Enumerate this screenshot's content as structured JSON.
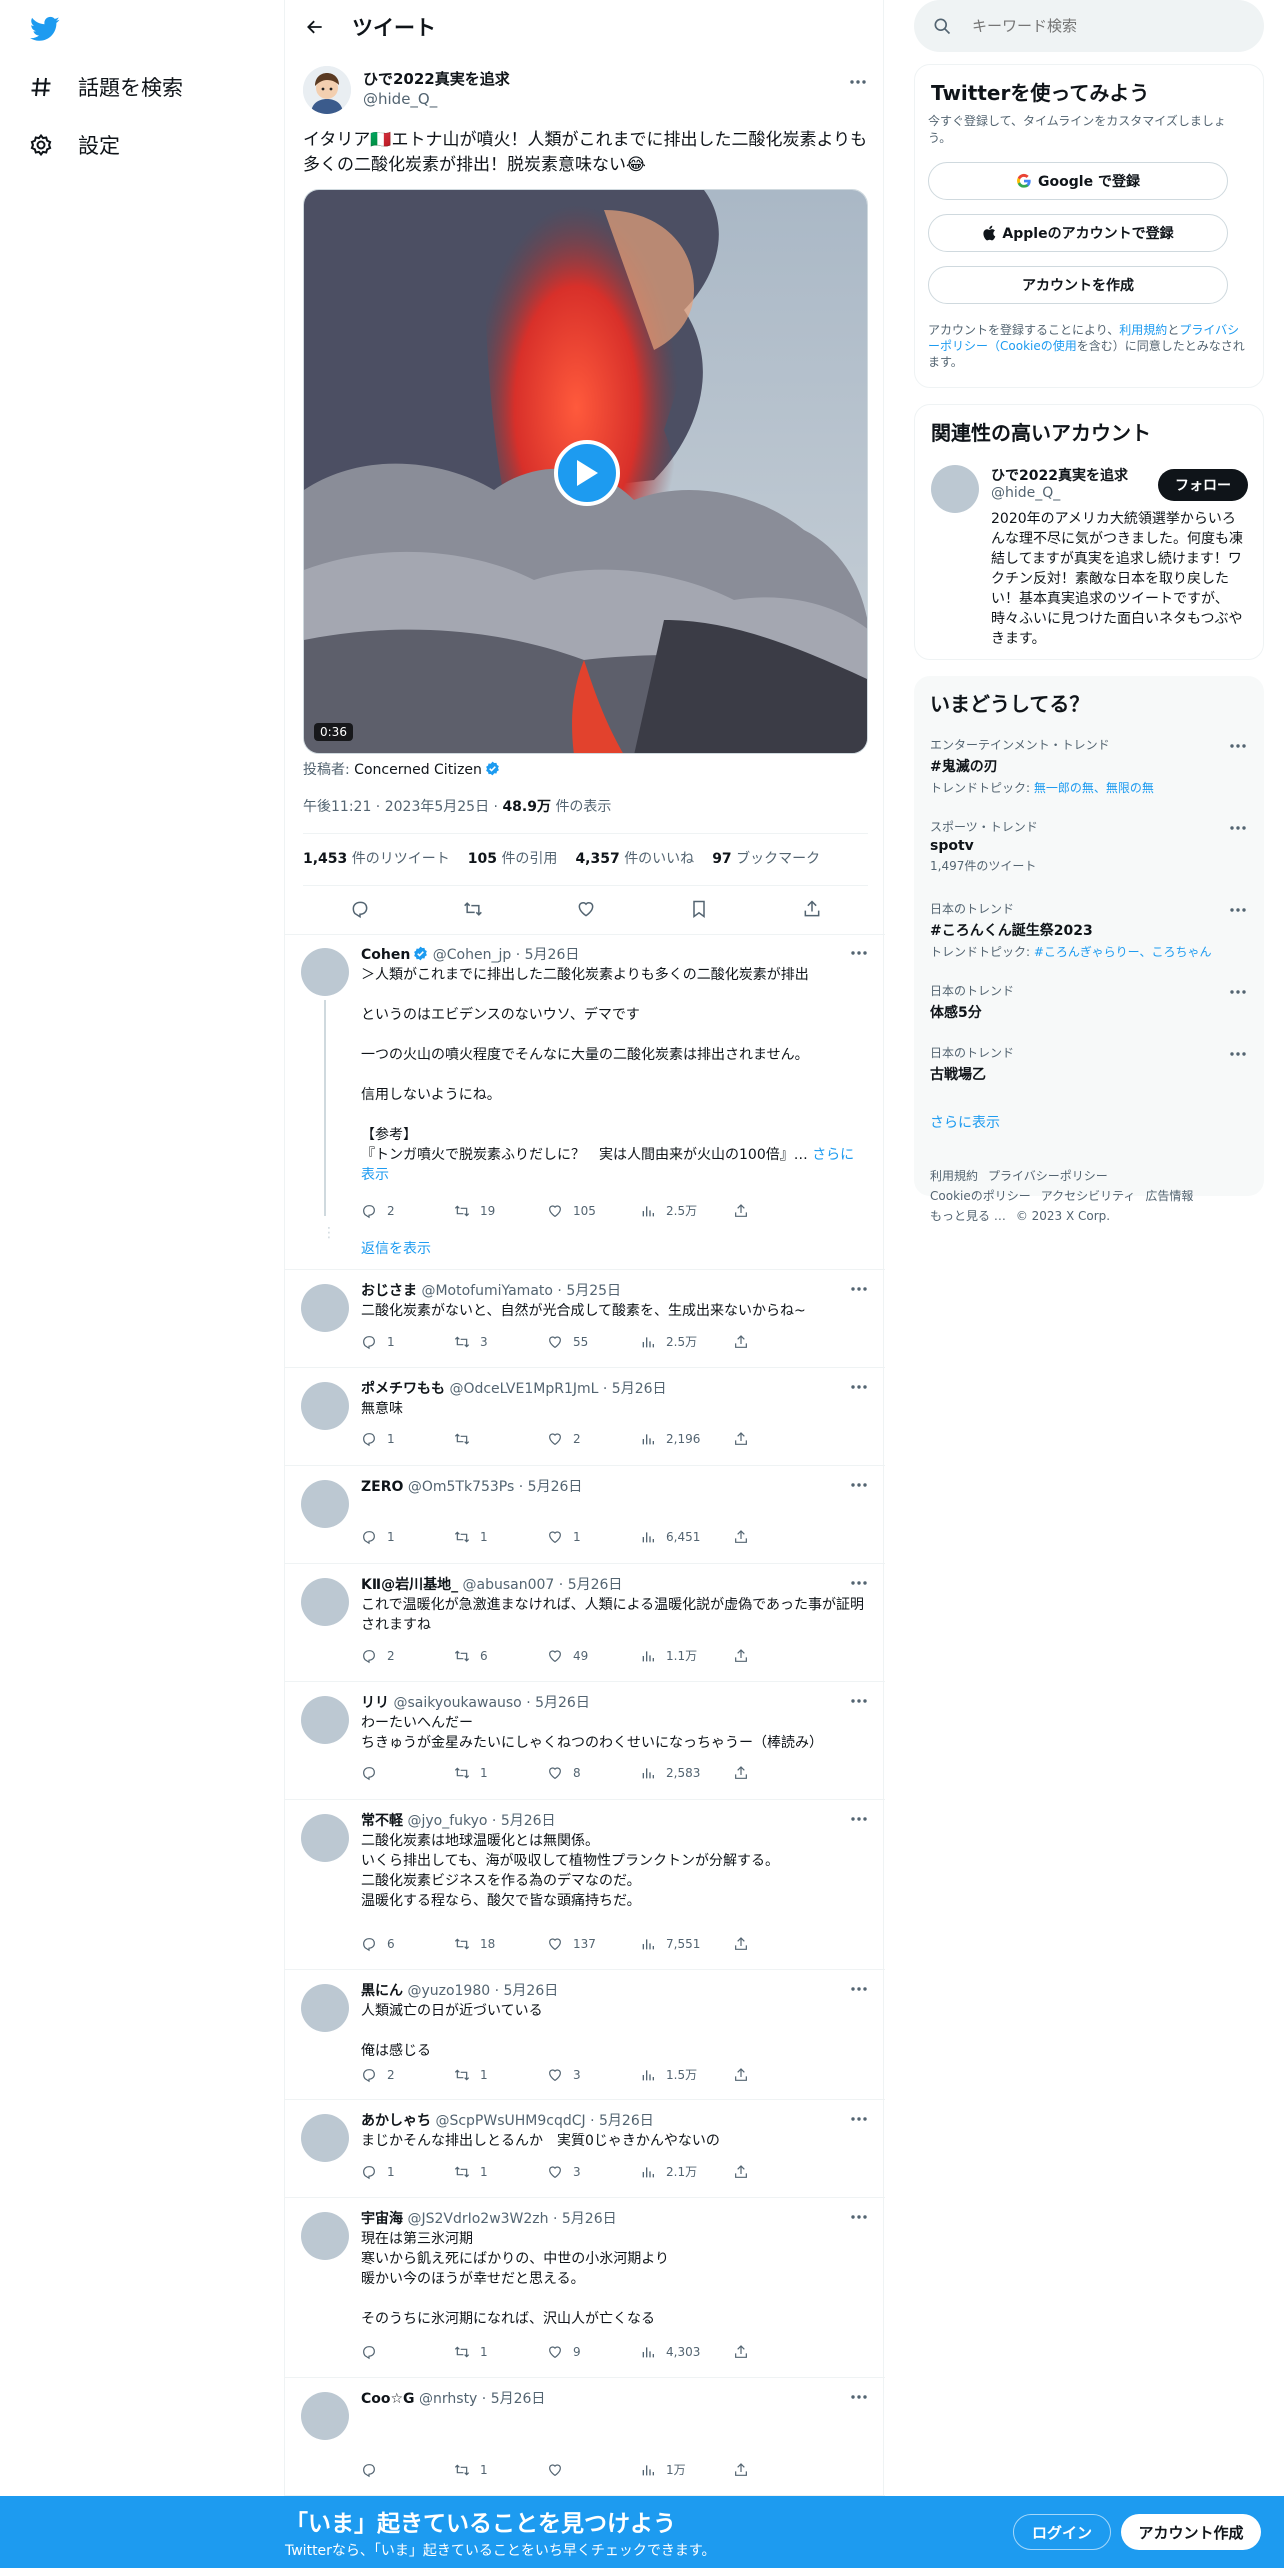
{
  "nav": {
    "explore_label": "話題を検索",
    "settings_label": "設定"
  },
  "header": {
    "title": "ツイート"
  },
  "tweet": {
    "author_name": "ひで2022真実を追求",
    "author_handle": "@hide_Q_",
    "text": "イタリア🇮🇹エトナ山が噴火！人類がこれまでに排出した二酸化炭素よりも多くの二酸化炭素が排出！脱炭素意味ない😂",
    "video_duration": "0:36",
    "poster_prefix": "投稿者: ",
    "poster_name": "Concerned Citizen",
    "time": "午後11:21",
    "date": "2023年5月25日",
    "views": "48.9万",
    "views_label": "件の表示",
    "retweets": "1,453",
    "retweets_label": "件のリツイート",
    "quotes": "105",
    "quotes_label": "件の引用",
    "likes": "4,357",
    "likes_label": "件のいいね",
    "bookmarks": "97",
    "bookmarks_label": "ブックマーク"
  },
  "replies": [
    {
      "name": "Cohen",
      "verified": true,
      "handle": "@Cohen_jp",
      "date": "5月26日",
      "text": "＞人類がこれまでに排出した二酸化炭素よりも多くの二酸化炭素が排出\n\nというのはエビデンスのないウソ、デマです\n\n一つの火山の噴火程度でそんなに大量の二酸化炭素は排出されません。\n\n信用しないようにね。\n\n【参考】\n『トンガ噴火で脱炭素ふりだしに？　実は人間由来が火山の100倍』…",
      "show_more": "さらに表示",
      "replies": "2",
      "retweets": "19",
      "likes": "105",
      "views": "2.5万",
      "thread_link": "返信を表示"
    },
    {
      "name": "おじさま",
      "handle": "@MotofumiYamato",
      "date": "5月25日",
      "text": "二酸化炭素がないと、自然が光合成して酸素を、生成出来ないからね~",
      "replies": "1",
      "retweets": "3",
      "likes": "55",
      "views": "2.5万"
    },
    {
      "name": "ポメチワもも",
      "handle": "@OdceLVE1MpR1JmL",
      "date": "5月26日",
      "text": "無意味",
      "replies": "1",
      "retweets": "",
      "likes": "2",
      "views": "2,196"
    },
    {
      "name": "ZERO",
      "handle": "@Om5Tk753Ps",
      "date": "5月26日",
      "text": "",
      "replies": "1",
      "retweets": "1",
      "likes": "1",
      "views": "6,451"
    },
    {
      "name": "KⅡ@岩川基地_",
      "handle": "@abusan007",
      "date": "5月26日",
      "text": "これで温暖化が急激進まなければ、人類による温暖化説が虚偽であった事が証明されますね",
      "replies": "2",
      "retweets": "6",
      "likes": "49",
      "views": "1.1万"
    },
    {
      "name": "リリ",
      "handle": "@saikyoukawauso",
      "date": "5月26日",
      "text": "わーたいへんだー\nちきゅうが金星みたいにしゃくねつのわくせいになっちゃうー（棒読み）",
      "replies": "",
      "retweets": "1",
      "likes": "8",
      "views": "2,583"
    },
    {
      "name": "常不軽",
      "handle": "@jyo_fukyo",
      "date": "5月26日",
      "text": "二酸化炭素は地球温暖化とは無関係。\nいくら排出しても、海が吸収して植物性プランクトンが分解する。\n二酸化炭素ビジネスを作る為のデマなのだ。\n温暖化する程なら、酸欠で皆な頭痛持ちだ。",
      "replies": "6",
      "retweets": "18",
      "likes": "137",
      "views": "7,551"
    },
    {
      "name": "黒にん",
      "handle": "@yuzo1980",
      "date": "5月26日",
      "text": "人類滅亡の日が近づいている\n\n俺は感じる",
      "replies": "2",
      "retweets": "1",
      "likes": "3",
      "views": "1.5万"
    },
    {
      "name": "あかしゃち",
      "handle": "@ScpPWsUHM9cqdCJ",
      "date": "5月26日",
      "text": "まじかそんな排出しとるんか　実質0じゃきかんやないの",
      "replies": "1",
      "retweets": "1",
      "likes": "3",
      "views": "2.1万"
    },
    {
      "name": "宇宙海",
      "handle": "@JS2VdrIo2w3W2zh",
      "date": "5月26日",
      "text": "現在は第三氷河期\n寒いから飢え死にばかりの、中世の小氷河期より\n暖かい今のほうが幸せだと思える。\n\nそのうちに氷河期になれば、沢山人が亡くなる",
      "replies": "",
      "retweets": "1",
      "likes": "9",
      "views": "4,303"
    },
    {
      "name": "Coo☆G",
      "handle": "@nrhsty",
      "date": "5月26日",
      "text": "",
      "replies": "",
      "retweets": "1",
      "likes": "",
      "views": "1万"
    }
  ],
  "search": {
    "placeholder": "キーワード検索"
  },
  "signup": {
    "title": "Twitterを使ってみよう",
    "subtitle": "今すぐ登録して、タイムラインをカスタマイズしましょう。",
    "google_label": "Google で登録",
    "apple_label": "Appleのアカウントで登録",
    "create_label": "アカウントを作成",
    "terms_1": "アカウントを登録することにより、",
    "terms_link1": "利用規約",
    "terms_2": "と",
    "terms_link2": "プライバシーポリシー（Cookieの使用",
    "terms_3": "を含む）に同意したとみなされます。"
  },
  "related": {
    "title": "関連性の高いアカウント",
    "name": "ひで2022真実を追求",
    "handle": "@hide_Q_",
    "follow_label": "フォロー",
    "bio": "2020年のアメリカ大統領選挙からいろんな理不尽に気がつきました。何度も凍結してますが真実を追求し続けます！ワクチン反対！素敵な日本を取り戻したい！基本真実追求のツイートですが、時々ふいに見つけた面白いネタもつぶやきます。"
  },
  "trends": {
    "title": "いまどうしてる？",
    "items": [
      {
        "context": "エンターテインメント・トレンド",
        "name": "#鬼滅の刃",
        "sub_prefix": "トレンドトピック: ",
        "sub_link": "無一郎の無、無限の無"
      },
      {
        "context": "スポーツ・トレンド",
        "name": "spotv",
        "sub_prefix": "1,497件のツイート",
        "sub_link": ""
      },
      {
        "context": "日本のトレンド",
        "name": "#ころんくん誕生祭2023",
        "sub_prefix": "トレンドトピック: ",
        "sub_link": "#ころんぎゃらりー、ころちゃん"
      },
      {
        "context": "日本のトレンド",
        "name": "体感5分",
        "sub_prefix": "",
        "sub_link": ""
      },
      {
        "context": "日本のトレンド",
        "name": "古戦場乙",
        "sub_prefix": "",
        "sub_link": ""
      }
    ],
    "show_more": "さらに表示"
  },
  "footer": {
    "links": [
      "利用規約",
      "プライバシーポリシー",
      "Cookieのポリシー",
      "アクセシビリティ",
      "広告情報",
      "もっと見る …"
    ],
    "copyright": "© 2023 X Corp."
  },
  "bottom_bar": {
    "headline": "「いま」起きていることを見つけよう",
    "sub": "Twitterなら、「いま」起きていることをいち早くチェックできます。",
    "login_label": "ログイン",
    "signup_label": "アカウント作成"
  },
  "colors": {
    "accent": "#1d9bf0",
    "text": "#0f1419",
    "muted": "#536471"
  }
}
